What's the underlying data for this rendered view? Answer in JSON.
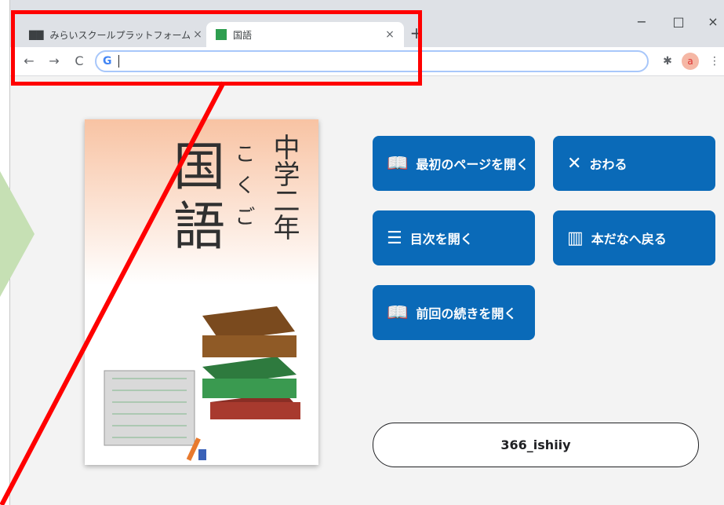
{
  "browser": {
    "tabs": [
      {
        "label": "みらいスクールプラットフォーム",
        "close": "×"
      },
      {
        "label": "国語",
        "close": "×"
      }
    ],
    "new_tab": "+",
    "window_controls": {
      "minimize": "−",
      "maximize": "□",
      "close": "×"
    },
    "nav": {
      "back": "←",
      "forward": "→",
      "reload": "C"
    },
    "omnibox": {
      "value": "",
      "logo": "G"
    },
    "avatar_letter": "a"
  },
  "book": {
    "title_kanji": [
      "国",
      "語"
    ],
    "ruby": "こくご",
    "grade": "中学二年"
  },
  "actions": [
    {
      "label": "最初のページを開く",
      "icon": "open-book-icon"
    },
    {
      "label": "おわる",
      "icon": "close-icon"
    },
    {
      "label": "目次を開く",
      "icon": "list-icon"
    },
    {
      "label": "本だなへ戻る",
      "icon": "bookshelf-icon"
    },
    {
      "label": "前回の続きを開く",
      "icon": "open-book-icon"
    }
  ],
  "user": {
    "name": "366_ishiiy"
  },
  "colors": {
    "button": "#0a6ab8",
    "highlight": "#ff0000",
    "arrow": "#c6e0b4"
  }
}
